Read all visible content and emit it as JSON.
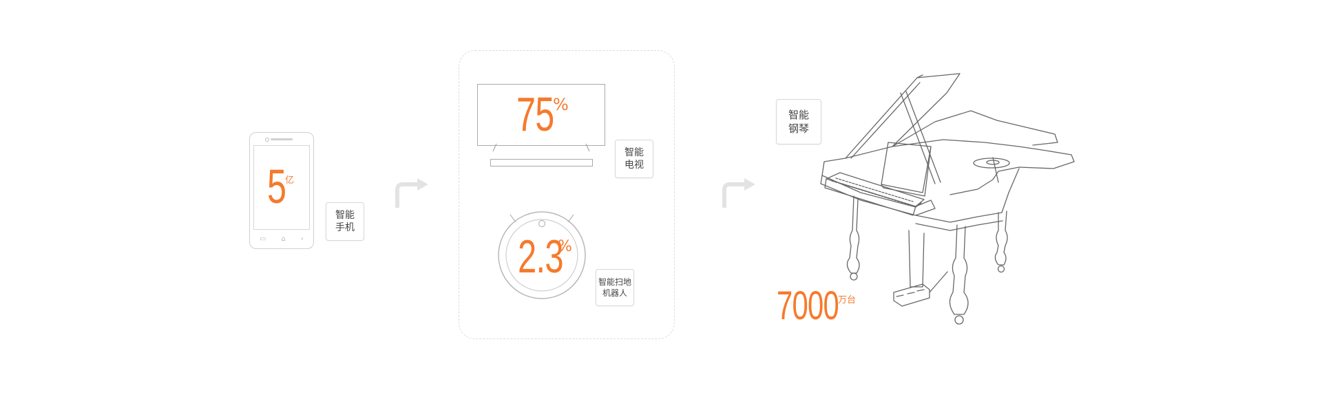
{
  "accent": "#f57a2c",
  "stage1": {
    "value": "5",
    "unit": "亿",
    "label_line1": "智能",
    "label_line2": "手机",
    "device_icon": "smartphone-icon",
    "nav_keys": [
      "▭",
      "⌂",
      "‹"
    ]
  },
  "stage2": {
    "tv": {
      "value": "75",
      "unit": "%",
      "label_line1": "智能",
      "label_line2": "电视",
      "device_icon": "television-icon"
    },
    "robot": {
      "value": "2.3",
      "unit": "%",
      "label_line1": "智能扫地",
      "label_line2": "机器人",
      "device_icon": "robot-vacuum-icon"
    }
  },
  "stage3": {
    "value": "7000",
    "unit": "万台",
    "label_line1": "智能",
    "label_line2": "钢琴",
    "device_icon": "grand-piano-icon"
  },
  "arrows": [
    "turn-right-arrow-icon",
    "turn-right-arrow-icon"
  ]
}
